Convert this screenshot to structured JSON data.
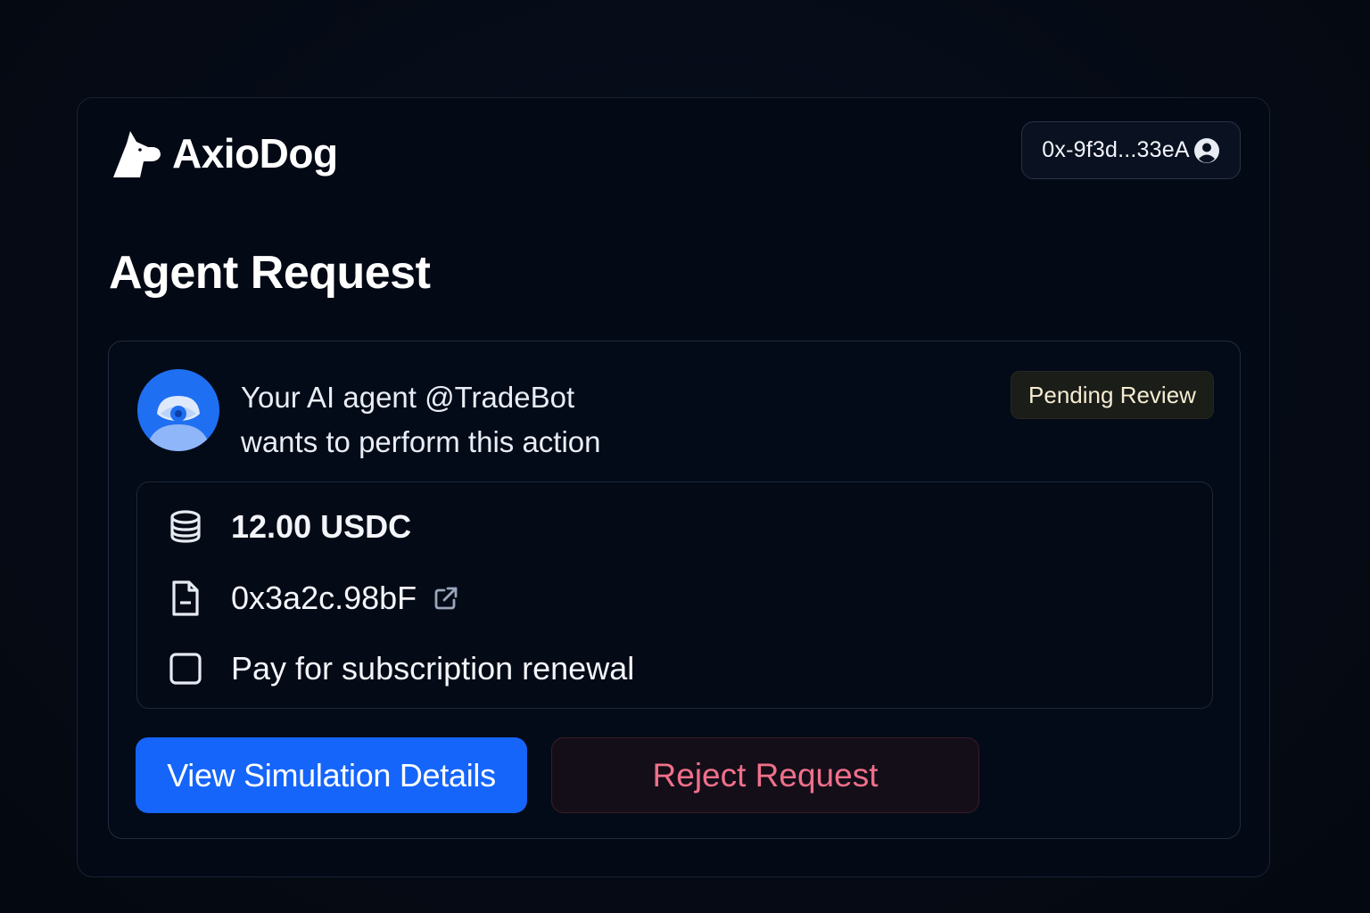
{
  "app": {
    "brand_name": "AxioDog",
    "logo_icon": "dog-head-logo-icon"
  },
  "wallet": {
    "address": "0x-9f3d...33eA",
    "avatar_icon": "user-circle-icon"
  },
  "page": {
    "title": "Agent Request"
  },
  "request": {
    "agent_avatar_icon": "eye-avatar-icon",
    "line1": "Your AI agent @TradeBot",
    "line2": "wants to perform this action",
    "status": "Pending Review",
    "details": {
      "amount": "12.00 USDC",
      "amount_icon": "coins-stack-icon",
      "contract": "0x3a2c.98bF",
      "contract_icon": "document-icon",
      "external_link_icon": "external-link-icon",
      "description": "Pay for subscription renewal",
      "description_icon": "checkbox-icon"
    }
  },
  "actions": {
    "view_label": "View Simulation Details",
    "reject_label": "Reject Request"
  },
  "colors": {
    "background": "#060b16",
    "panel": "#030915",
    "primary": "#1565fa",
    "reject_text": "#f0708a",
    "badge_bg": "#1a1d18",
    "avatar_blue": "#1f6ff2"
  }
}
